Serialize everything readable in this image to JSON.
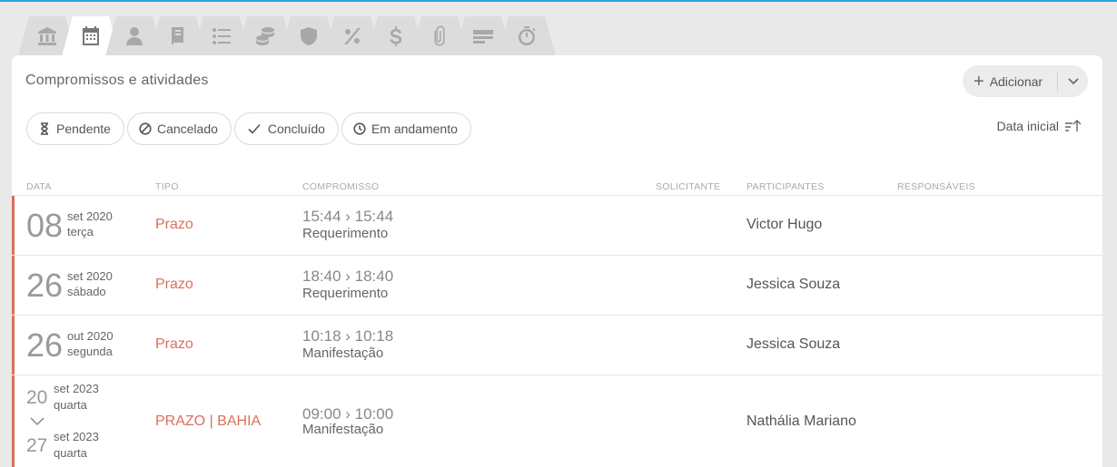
{
  "tabs": [
    {
      "name": "bank-icon",
      "active": false
    },
    {
      "name": "calendar-icon",
      "active": true
    },
    {
      "name": "person-icon",
      "active": false
    },
    {
      "name": "book-icon",
      "active": false
    },
    {
      "name": "list-icon",
      "active": false
    },
    {
      "name": "coins-icon",
      "active": false
    },
    {
      "name": "shield-icon",
      "active": false
    },
    {
      "name": "percent-icon",
      "active": false
    },
    {
      "name": "dollar-icon",
      "active": false
    },
    {
      "name": "paperclip-icon",
      "active": false
    },
    {
      "name": "bars-icon",
      "active": false
    },
    {
      "name": "stopwatch-icon",
      "active": false
    }
  ],
  "header": {
    "title": "Compromissos e atividades",
    "add_label": "Adicionar"
  },
  "filters": {
    "pendente": "Pendente",
    "cancelado": "Cancelado",
    "concluido": "Concluído",
    "andamento": "Em andamento"
  },
  "sort": {
    "label": "Data inicial"
  },
  "columns": {
    "data": "DATA",
    "tipo": "TIPO",
    "compromisso": "COMPROMISSO",
    "solicitante": "SOLICITANTE",
    "participantes": "PARTICIPANTES",
    "responsaveis": "RESPONSÁVEIS"
  },
  "rows": [
    {
      "day": "08",
      "month": "set 2020",
      "weekday": "terça",
      "tipo": "Prazo",
      "time": "15:44 › 15:44",
      "desc": "Requerimento",
      "participante": "Victor Hugo"
    },
    {
      "day": "26",
      "month": "set 2020",
      "weekday": "sábado",
      "tipo": "Prazo",
      "time": "18:40 › 18:40",
      "desc": "Requerimento",
      "participante": "Jessica Souza"
    },
    {
      "day": "26",
      "month": "out 2020",
      "weekday": "segunda",
      "tipo": "Prazo",
      "time": "10:18 › 10:18",
      "desc": "Manifestação",
      "participante": "Jessica Souza"
    },
    {
      "start_day": "20",
      "start_month": "set 2023",
      "start_weekday": "quarta",
      "end_day": "27",
      "end_month": "set 2023",
      "end_weekday": "quarta",
      "tipo": "PRAZO | BAHIA",
      "time": "09:00 › 10:00",
      "desc": "Manifestação",
      "participante": "Nathália Mariano"
    }
  ],
  "colors": {
    "accent": "#d9705a",
    "top_line": "#2aa7e0"
  }
}
